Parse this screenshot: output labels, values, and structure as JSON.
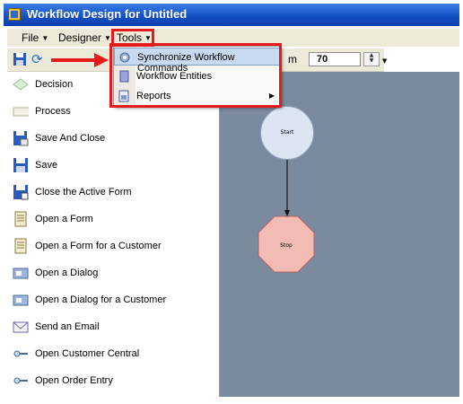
{
  "window": {
    "title": "Workflow Design for Untitled"
  },
  "menubar": {
    "items": [
      {
        "label": "File"
      },
      {
        "label": "Designer"
      },
      {
        "label": "Tools"
      }
    ]
  },
  "toolbar": {
    "zoom_fragment": "m",
    "zoom_value": "70"
  },
  "tools_menu": {
    "items": [
      {
        "label": "Synchronize Workflow Commands",
        "icon": "gear-icon",
        "highlighted": true
      },
      {
        "label": "Workflow Entities",
        "icon": "database-icon"
      },
      {
        "label": "Reports",
        "icon": "report-icon",
        "has_submenu": true
      }
    ]
  },
  "palette": {
    "items": [
      {
        "label": "Decision",
        "icon": "diamond-shape-icon"
      },
      {
        "label": "Process",
        "icon": "rectangle-shape-icon"
      },
      {
        "label": "Save And Close",
        "icon": "floppy-close-icon"
      },
      {
        "label": "Save",
        "icon": "floppy-disk-icon"
      },
      {
        "label": "Close the Active Form",
        "icon": "close-form-icon"
      },
      {
        "label": "Open a Form",
        "icon": "form-icon"
      },
      {
        "label": "Open a Form for a Customer",
        "icon": "customer-form-icon"
      },
      {
        "label": "Open a Dialog",
        "icon": "dialog-icon"
      },
      {
        "label": "Open a Dialog for a Customer",
        "icon": "customer-dialog-icon"
      },
      {
        "label": "Send an Email",
        "icon": "envelope-icon"
      },
      {
        "label": "Open Customer Central",
        "icon": "key-icon"
      },
      {
        "label": "Open Order Entry",
        "icon": "key-icon"
      }
    ]
  },
  "diagram": {
    "start_label": "Start",
    "stop_label": "Stop"
  },
  "colors": {
    "title_bar": "#1550c4",
    "highlight_frame": "#e51a1a",
    "canvas_bg": "#7c8aa0",
    "start_node": "#dbe6f2",
    "stop_node": "#f2bcb5"
  }
}
